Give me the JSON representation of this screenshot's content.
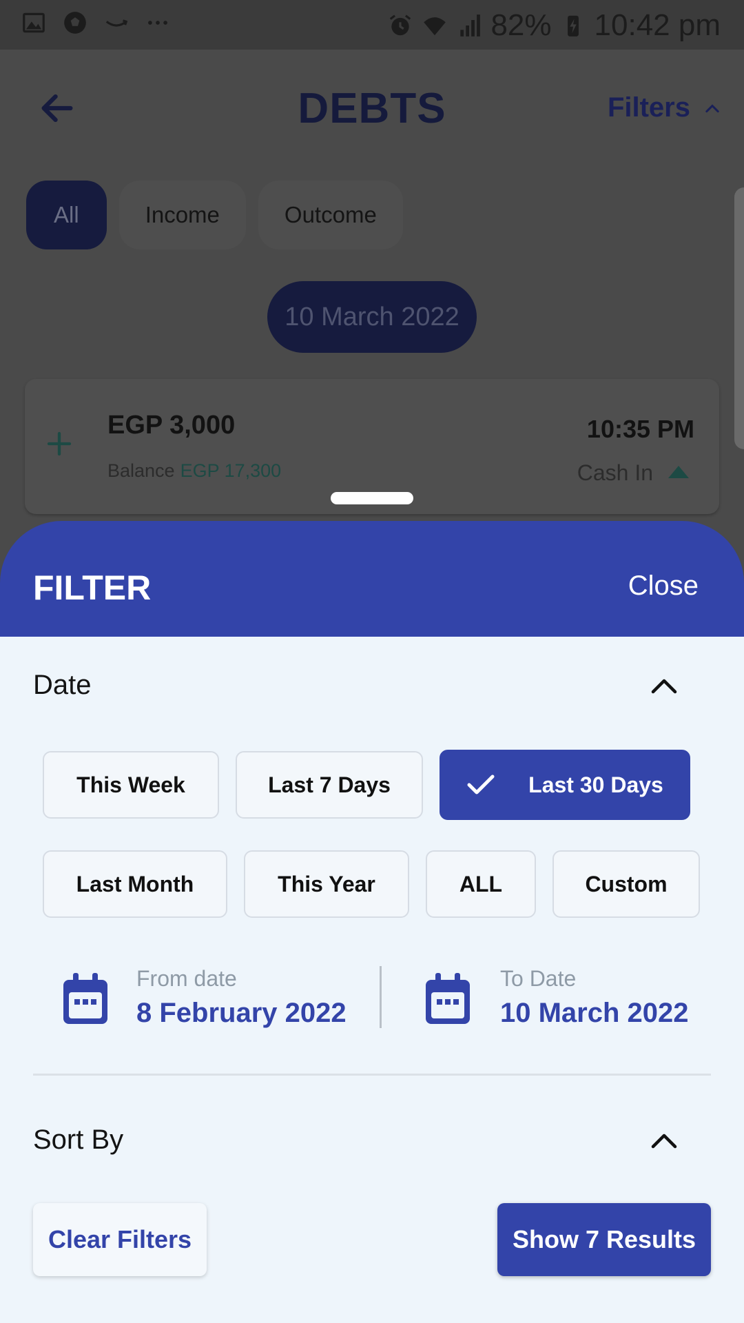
{
  "status_bar": {
    "battery": "82%",
    "time": "10:42 pm",
    "left_icons": [
      "gallery-icon",
      "soccer-ball-icon",
      "amazon-smile-icon",
      "more-dots-icon"
    ],
    "right_icons": [
      "alarm-icon",
      "wifi-icon",
      "signal-icon",
      "battery-charging-icon"
    ]
  },
  "header": {
    "title": "DEBTS",
    "filters_label": "Filters"
  },
  "tabs": [
    {
      "label": "All",
      "active": true
    },
    {
      "label": "Income",
      "active": false
    },
    {
      "label": "Outcome",
      "active": false
    }
  ],
  "date_pill": "10 March 2022",
  "transaction": {
    "amount": "EGP 3,000",
    "balance_label": "Balance",
    "balance_value": "EGP 17,300",
    "time": "10:35 PM",
    "type": "Cash In"
  },
  "filter_sheet": {
    "title": "FILTER",
    "close_label": "Close",
    "date_section": {
      "label": "Date",
      "options_row1": [
        "This Week",
        "Last 7 Days",
        "Last 30 Days"
      ],
      "options_row2": [
        "Last Month",
        "This Year",
        "ALL",
        "Custom"
      ],
      "selected": "Last 30 Days",
      "from_caption": "From date",
      "from_value": "8 February 2022",
      "to_caption": "To Date",
      "to_value": "10 March 2022"
    },
    "sort_section": {
      "label": "Sort By"
    },
    "clear_label": "Clear Filters",
    "show_label": "Show 7 Results"
  },
  "colors": {
    "primary": "#3344a9",
    "dark_navy": "#161b3e",
    "sheet_background": "#eef5fb",
    "positive_green": "#1d4a44"
  }
}
